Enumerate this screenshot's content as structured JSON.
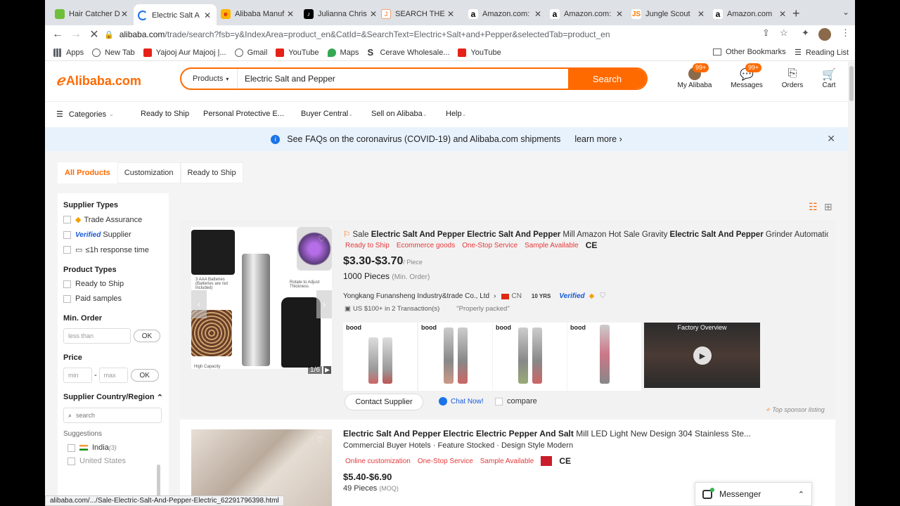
{
  "browser": {
    "tabs": [
      {
        "title": "Hair Catcher D",
        "icon": "leaf-icon",
        "color": "#6fbf3a"
      },
      {
        "title": "Electric Salt A",
        "icon": "loading-spinner-icon",
        "color": "#1a73e8",
        "active": true
      },
      {
        "title": "Alibaba Manuf",
        "icon": "alibaba-icon",
        "color": "#ffb300"
      },
      {
        "title": "Julianna Chris",
        "icon": "tiktok-icon",
        "color": "#000000"
      },
      {
        "title": "SEARCH THE",
        "icon": "junglescout-icon",
        "color": "#f0a070"
      },
      {
        "title": "Amazon.com:",
        "icon": "amazon-icon",
        "color": "#000000"
      },
      {
        "title": "Amazon.com:",
        "icon": "amazon-icon",
        "color": "#000000"
      },
      {
        "title": "Jungle Scout",
        "icon": "junglescout-icon",
        "color": "#ff7a00"
      },
      {
        "title": "Amazon.com",
        "icon": "amazon-icon",
        "color": "#000000"
      }
    ],
    "url_domain": "alibaba.com",
    "url_path": "/trade/search?fsb=y&IndexArea=product_en&CatId=&SearchText=Electric+Salt+and+Pepper&selectedTab=product_en",
    "bookmarks": [
      {
        "label": "Apps",
        "icon": "apps-grid-icon",
        "color": "#5f6368"
      },
      {
        "label": "New Tab",
        "icon": "globe-icon",
        "color": "#5f6368"
      },
      {
        "label": "Yajooj Aur Majooj |...",
        "icon": "youtube-icon",
        "color": "#e62117"
      },
      {
        "label": "Gmail",
        "icon": "globe-icon",
        "color": "#5f6368"
      },
      {
        "label": "YouTube",
        "icon": "youtube-icon",
        "color": "#e62117"
      },
      {
        "label": "Maps",
        "icon": "maps-pin-icon",
        "color": "#34a853"
      },
      {
        "label": "Cerave Wholesale...",
        "icon": "s-logo-icon",
        "color": "#222222"
      },
      {
        "label": "YouTube",
        "icon": "youtube-icon",
        "color": "#e62117"
      }
    ],
    "other_bookmarks": "Other Bookmarks",
    "reading_list": "Reading List",
    "status_url": "alibaba.com/.../Sale-Electric-Salt-And-Pepper-Electric_62291796398.html"
  },
  "header": {
    "logo": "Alibaba.com",
    "search_category": "Products",
    "search_value": "Electric Salt and Pepper",
    "search_button": "Search",
    "my_alibaba": "My Alibaba",
    "my_alibaba_badge": "99+",
    "messages": "Messages",
    "messages_badge": "99+",
    "orders": "Orders",
    "cart": "Cart"
  },
  "catnav": {
    "categories": "Categories",
    "items": [
      "Ready to Ship",
      "Personal Protective E...",
      "Buyer Central",
      "Sell on Alibaba",
      "Help"
    ]
  },
  "banner": {
    "text": "See FAQs on the coronavirus (COVID-19) and Alibaba.com shipments",
    "link": "learn more"
  },
  "product_tabs": [
    "All Products",
    "Customization",
    "Ready to Ship"
  ],
  "sidebar": {
    "supplier_types_title": "Supplier Types",
    "trade_assurance": "Trade Assurance",
    "verified_prefix": "Verified",
    "verified_suffix": "Supplier",
    "response_time": "≤1h response time",
    "product_types_title": "Product Types",
    "ready_to_ship": "Ready to Ship",
    "paid_samples": "Paid samples",
    "min_order_title": "Min. Order",
    "min_order_placeholder": "less than",
    "ok": "OK",
    "price_title": "Price",
    "price_min": "min",
    "price_dash": "-",
    "price_max": "max",
    "country_title": "Supplier Country/Region",
    "country_search": "search",
    "suggestions": "Suggestions",
    "country_1": "India",
    "country_1_count": "(3)",
    "country_2": "United States"
  },
  "product1": {
    "title_prefix": "Sale ",
    "title_b1": "Electric Salt And Pepper Electric Salt And Pepper",
    "title_mid": " Mill Amazon Hot Sale Gravity ",
    "title_b2": "Electric Salt And Pepper",
    "title_end": " Grinder Automatic Op...",
    "tags": [
      "Ready to Ship",
      "Ecommerce goods",
      "One-Stop Service",
      "Sample Available"
    ],
    "ce": "CE",
    "price": "$3.30-$3.70",
    "unit": "/ Piece",
    "moq": "1000 Pieces",
    "moq_note": "(Min. Order)",
    "supplier": "Yongkang Funansheng Industry&trade Co., Ltd",
    "country": "CN",
    "years": "10 YRS",
    "verified": "Verified",
    "transactions": "US $100+ in 2 Transaction(s)",
    "review": "\"Properly packed\"",
    "image_counter": "1/6",
    "thumb_brand": "bood",
    "factory_overview": "Factory Overview",
    "contact": "Contact Supplier",
    "chat": "Chat Now!",
    "compare": "compare",
    "sponsor": "Top sponsor listing",
    "img_text_1": "3 AAA Batteries (Batteries are not included)",
    "img_text_2": "Rotate to Adjust Thickness",
    "img_text_3": "High Capacity"
  },
  "product2": {
    "title_b": "Electric Salt And Pepper Electric Electric Pepper And Salt",
    "title_end": " Mill LED Light New Design 304 Stainless Ste...",
    "subtitle": "Commercial Buyer Hotels · Feature Stocked · Design Style Modern",
    "tags": [
      "Online customization",
      "One-Stop Service",
      "Sample Available"
    ],
    "ce": "CE",
    "price": "$5.40-$6.90",
    "moq": "49 Pieces",
    "moq_note": "(MOQ)"
  },
  "messenger": "Messenger",
  "colors": {
    "accent": "#ff6a00",
    "tag_red": "#e4393c",
    "banner_bg": "#e8f2fd",
    "link_blue": "#1a73e8"
  }
}
